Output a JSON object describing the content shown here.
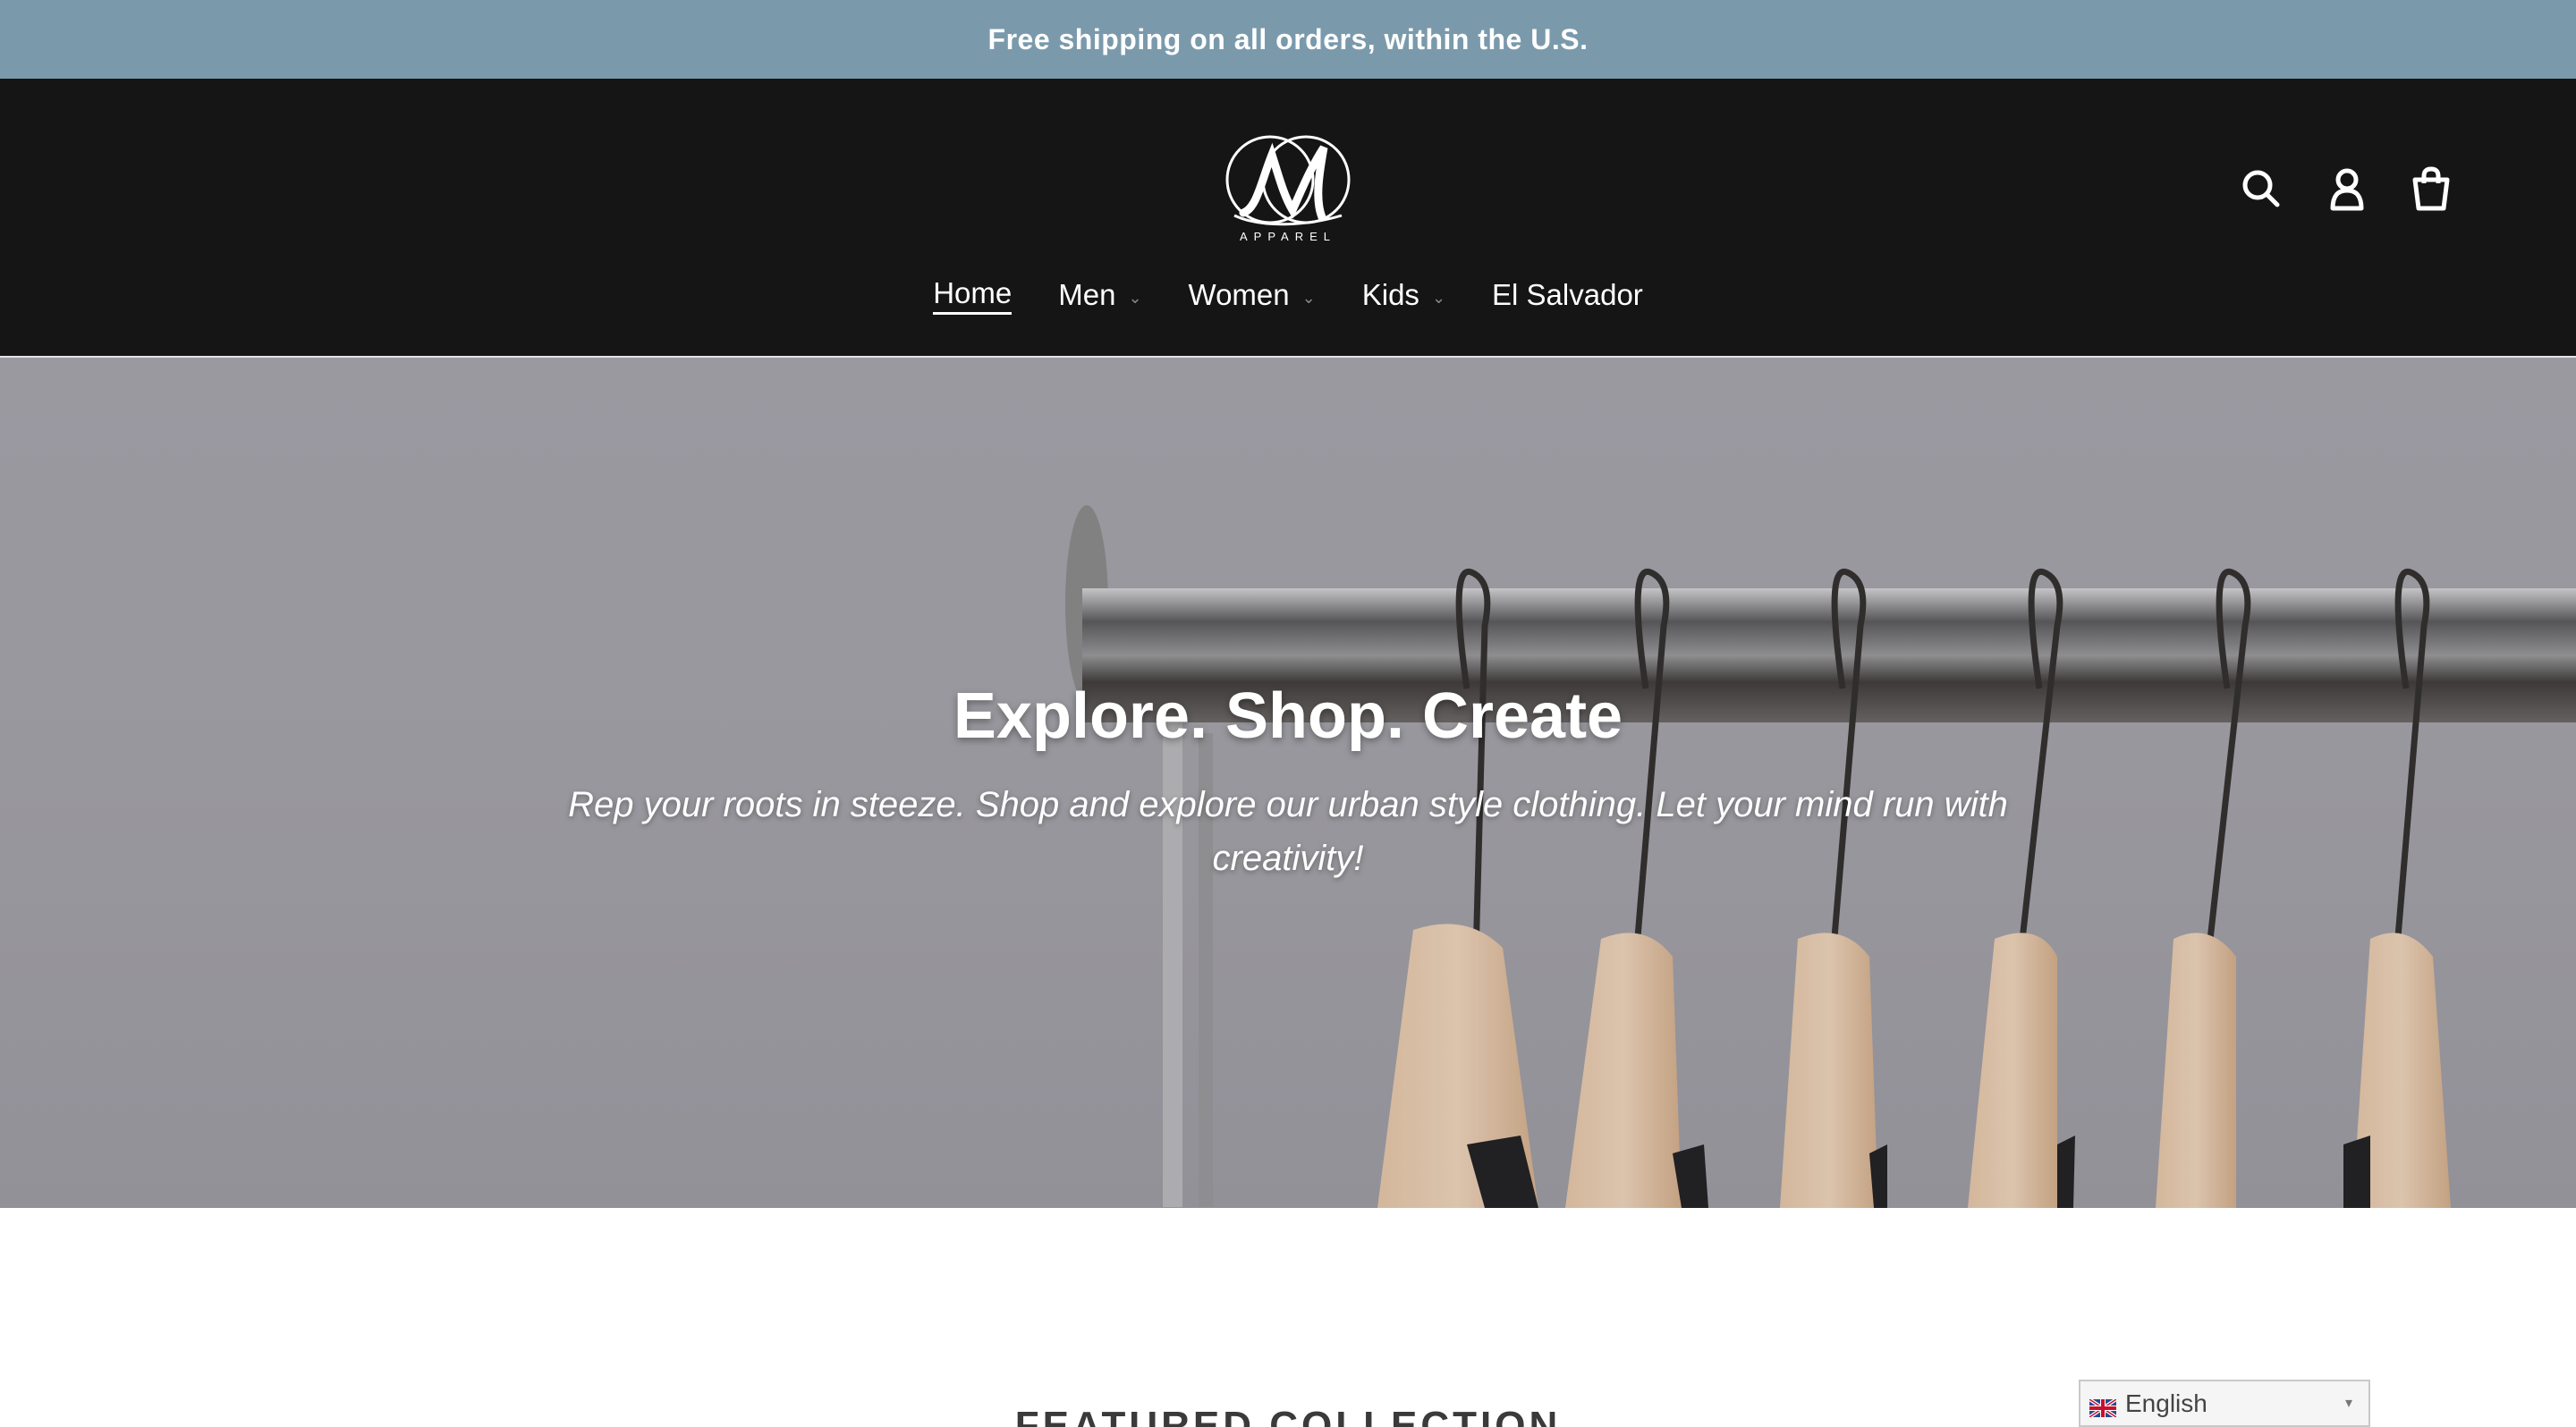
{
  "announcement": {
    "text": "Free shipping on all orders, within the U.S."
  },
  "header": {
    "logo_text": "APPAREL",
    "icons": [
      "search-icon",
      "account-icon",
      "cart-icon"
    ]
  },
  "nav": {
    "items": [
      {
        "label": "Home",
        "active": true,
        "dropdown": false
      },
      {
        "label": "Men",
        "active": false,
        "dropdown": true
      },
      {
        "label": "Women",
        "active": false,
        "dropdown": true
      },
      {
        "label": "Kids",
        "active": false,
        "dropdown": true
      },
      {
        "label": "El Salvador",
        "active": false,
        "dropdown": false
      }
    ],
    "chevron": "⌄"
  },
  "hero": {
    "title": "Explore. Shop. Create",
    "subtitle": "Rep your roots in steeze. Shop and explore our urban style clothing. Let your mind run with creativity!"
  },
  "featured": {
    "heading": "FEATURED COLLECTION"
  },
  "language": {
    "selected": "English",
    "caret": "▾"
  },
  "colors": {
    "announcement_bg": "#7a9aac",
    "header_bg": "#151515",
    "hero_bg": "#a6a5aa"
  }
}
